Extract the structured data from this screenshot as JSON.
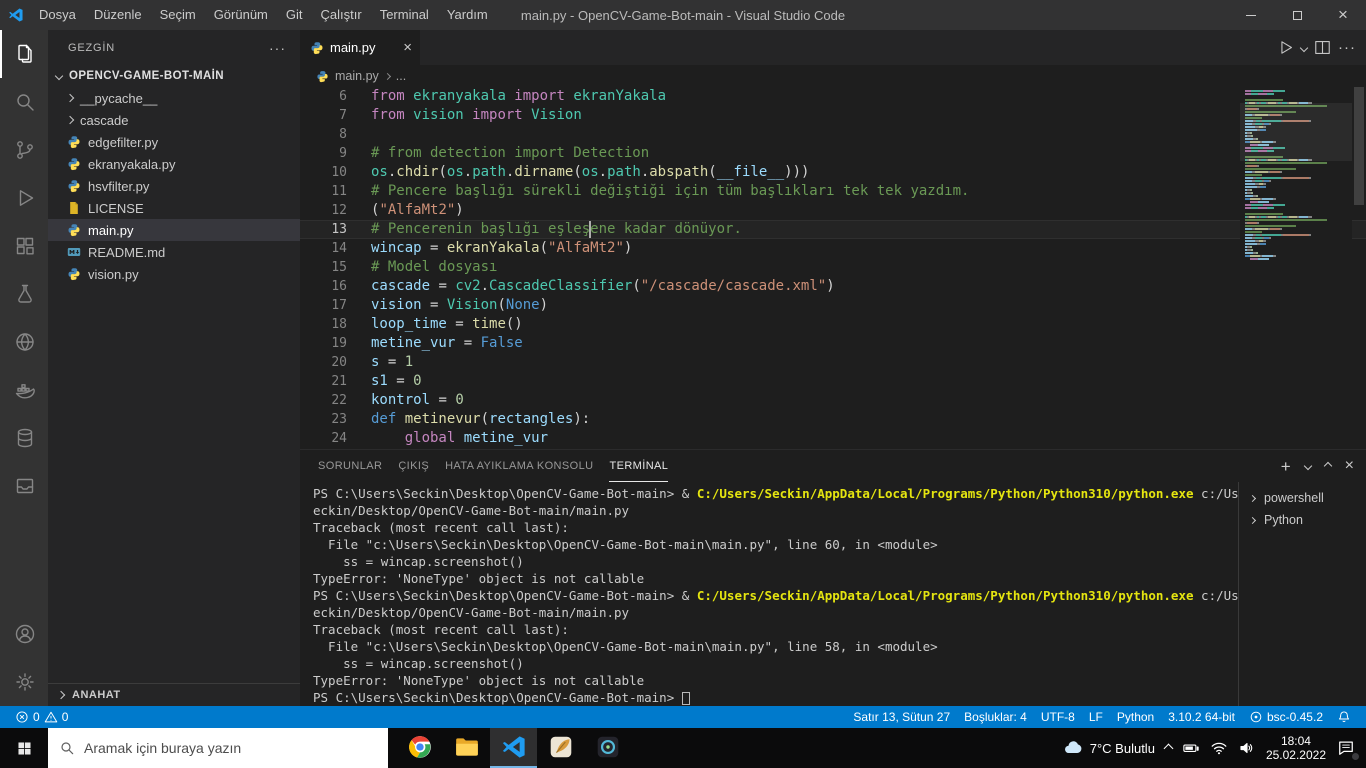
{
  "colors": {
    "accent": "#007acc",
    "titlebar": "#323233",
    "activitybar": "#333333",
    "sidebar": "#252526",
    "editor": "#1e1e1e",
    "taskbar": "#0b0b0c"
  },
  "titlebar": {
    "menus": [
      "Dosya",
      "Düzenle",
      "Seçim",
      "Görünüm",
      "Git",
      "Çalıştır",
      "Terminal",
      "Yardım"
    ],
    "title": "main.py - OpenCV-Game-Bot-main - Visual Studio Code"
  },
  "activitybar": {
    "top": [
      {
        "name": "explorer",
        "icon": "files",
        "active": true
      },
      {
        "name": "search",
        "icon": "search"
      },
      {
        "name": "source-control",
        "icon": "source-control"
      },
      {
        "name": "run-debug",
        "icon": "run-debug"
      },
      {
        "name": "extensions",
        "icon": "extensions"
      },
      {
        "name": "testing",
        "icon": "testing"
      },
      {
        "name": "remote-explorer",
        "icon": "globe"
      },
      {
        "name": "docker",
        "icon": "docker"
      },
      {
        "name": "database",
        "icon": "database"
      },
      {
        "name": "inbox",
        "icon": "inbox"
      }
    ],
    "bottom": [
      {
        "name": "account",
        "icon": "account"
      },
      {
        "name": "settings",
        "icon": "gear"
      }
    ]
  },
  "sidebar": {
    "title": "GEZGİN",
    "root_folder": "OPENCV-GAME-BOT-MAİN",
    "files": [
      {
        "name": "__pycache__",
        "type": "folder"
      },
      {
        "name": "cascade",
        "type": "folder"
      },
      {
        "name": "edgefilter.py",
        "type": "python"
      },
      {
        "name": "ekranyakala.py",
        "type": "python"
      },
      {
        "name": "hsvfilter.py",
        "type": "python"
      },
      {
        "name": "LICENSE",
        "type": "license"
      },
      {
        "name": "main.py",
        "type": "python",
        "selected": true
      },
      {
        "name": "README.md",
        "type": "markdown"
      },
      {
        "name": "vision.py",
        "type": "python"
      }
    ],
    "outline": "ANAHAT"
  },
  "editor": {
    "tab": {
      "label": "main.py"
    },
    "breadcrumb": {
      "file": "main.py",
      "ellipsis": "..."
    },
    "active_line": 13,
    "lines": [
      {
        "n": 6,
        "t": [
          [
            "from ",
            "kw"
          ],
          [
            "ekranyakala",
            "mod"
          ],
          [
            " import ",
            "kw"
          ],
          [
            "ekranYakala",
            "mod"
          ]
        ]
      },
      {
        "n": 7,
        "t": [
          [
            "from ",
            "kw"
          ],
          [
            "vision",
            "mod"
          ],
          [
            " import ",
            "kw"
          ],
          [
            "Vision",
            "mod"
          ]
        ]
      },
      {
        "n": 8,
        "t": []
      },
      {
        "n": 9,
        "t": [
          [
            "# from detection import Detection",
            "com"
          ]
        ]
      },
      {
        "n": 10,
        "t": [
          [
            "os",
            "mod"
          ],
          [
            ".",
            "pln"
          ],
          [
            "chdir",
            "fn"
          ],
          [
            "(",
            "pln"
          ],
          [
            "os",
            "mod"
          ],
          [
            ".",
            "pln"
          ],
          [
            "path",
            "mod"
          ],
          [
            ".",
            "pln"
          ],
          [
            "dirname",
            "fn"
          ],
          [
            "(",
            "pln"
          ],
          [
            "os",
            "mod"
          ],
          [
            ".",
            "pln"
          ],
          [
            "path",
            "mod"
          ],
          [
            ".",
            "pln"
          ],
          [
            "abspath",
            "fn"
          ],
          [
            "(",
            "pln"
          ],
          [
            "__file__",
            "var"
          ],
          [
            ")))",
            "pln"
          ]
        ]
      },
      {
        "n": 11,
        "t": [
          [
            "# Pencere başlığı sürekli değiştiği için tüm başlıkları tek tek yazdım.",
            "com"
          ]
        ]
      },
      {
        "n": 12,
        "t": [
          [
            "(",
            "pln"
          ],
          [
            "\"AlfaMt2\"",
            "str"
          ],
          [
            ")",
            "pln"
          ]
        ]
      },
      {
        "n": 13,
        "t": [
          [
            "# Pencerenin başlığı eşleş",
            "com"
          ],
          [
            "",
            "cur"
          ],
          [
            "ene kadar dönüyor.",
            "com"
          ]
        ]
      },
      {
        "n": 14,
        "t": [
          [
            "wincap",
            "var"
          ],
          [
            " = ",
            "pln"
          ],
          [
            "ekranYakala",
            "fn"
          ],
          [
            "(",
            "pln"
          ],
          [
            "\"AlfaMt2\"",
            "str"
          ],
          [
            ")",
            "pln"
          ]
        ]
      },
      {
        "n": 15,
        "t": [
          [
            "# Model dosyası",
            "com"
          ]
        ]
      },
      {
        "n": 16,
        "t": [
          [
            "cascade",
            "var"
          ],
          [
            " = ",
            "pln"
          ],
          [
            "cv2",
            "mod"
          ],
          [
            ".",
            "pln"
          ],
          [
            "CascadeClassifier",
            "mod"
          ],
          [
            "(",
            "pln"
          ],
          [
            "\"/cascade/cascade.xml\"",
            "str"
          ],
          [
            ")",
            "pln"
          ]
        ]
      },
      {
        "n": 17,
        "t": [
          [
            "vision",
            "var"
          ],
          [
            " = ",
            "pln"
          ],
          [
            "Vision",
            "mod"
          ],
          [
            "(",
            "pln"
          ],
          [
            "None",
            "cst"
          ],
          [
            ")",
            "pln"
          ]
        ]
      },
      {
        "n": 18,
        "t": [
          [
            "loop_time",
            "var"
          ],
          [
            " = ",
            "pln"
          ],
          [
            "time",
            "fn"
          ],
          [
            "()",
            "pln"
          ]
        ]
      },
      {
        "n": 19,
        "t": [
          [
            "metine_vur",
            "var"
          ],
          [
            " = ",
            "pln"
          ],
          [
            "False",
            "cst"
          ]
        ]
      },
      {
        "n": 20,
        "t": [
          [
            "s",
            "var"
          ],
          [
            " = ",
            "pln"
          ],
          [
            "1",
            "num"
          ]
        ]
      },
      {
        "n": 21,
        "t": [
          [
            "s1",
            "var"
          ],
          [
            " = ",
            "pln"
          ],
          [
            "0",
            "num"
          ]
        ]
      },
      {
        "n": 22,
        "t": [
          [
            "kontrol",
            "var"
          ],
          [
            " = ",
            "pln"
          ],
          [
            "0",
            "num"
          ]
        ]
      },
      {
        "n": 23,
        "t": [
          [
            "def ",
            "cst"
          ],
          [
            "metinevur",
            "fn"
          ],
          [
            "(",
            "pln"
          ],
          [
            "rectangles",
            "var"
          ],
          [
            "):",
            "pln"
          ]
        ]
      },
      {
        "n": 24,
        "t": [
          [
            "    ",
            "pln"
          ],
          [
            "global ",
            "kw"
          ],
          [
            "metine_vur",
            "var"
          ]
        ]
      }
    ]
  },
  "panel": {
    "tabs": [
      {
        "label": "SORUNLAR"
      },
      {
        "label": "ÇIKIŞ"
      },
      {
        "label": "HATA AYIKLAMA KONSOLU"
      },
      {
        "label": "TERMİNAL",
        "active": true
      }
    ],
    "terminal_lines": [
      [
        [
          "PS C:\\Users\\Seckin\\Desktop\\OpenCV-Game-Bot-main> & ",
          "p"
        ],
        [
          "C:/Users/Seckin/AppData/Local/Programs/Python/Python310/python.exe",
          "y"
        ],
        [
          " c:/Users/S",
          "p"
        ]
      ],
      [
        [
          "eckin/Desktop/OpenCV-Game-Bot-main/main.py",
          "p"
        ]
      ],
      [
        [
          "Traceback (most recent call last):",
          "p"
        ]
      ],
      [
        [
          "  File \"c:\\Users\\Seckin\\Desktop\\OpenCV-Game-Bot-main\\main.py\", line 60, in <module>",
          "p"
        ]
      ],
      [
        [
          "    ss = wincap.screenshot()",
          "p"
        ]
      ],
      [
        [
          "TypeError: 'NoneType' object is not callable",
          "p"
        ]
      ],
      [
        [
          "PS C:\\Users\\Seckin\\Desktop\\OpenCV-Game-Bot-main> & ",
          "p"
        ],
        [
          "C:/Users/Seckin/AppData/Local/Programs/Python/Python310/python.exe",
          "y"
        ],
        [
          " c:/Users/S",
          "p"
        ]
      ],
      [
        [
          "eckin/Desktop/OpenCV-Game-Bot-main/main.py",
          "p"
        ]
      ],
      [
        [
          "Traceback (most recent call last):",
          "p"
        ]
      ],
      [
        [
          "  File \"c:\\Users\\Seckin\\Desktop\\OpenCV-Game-Bot-main\\main.py\", line 58, in <module>",
          "p"
        ]
      ],
      [
        [
          "    ss = wincap.screenshot()",
          "p"
        ]
      ],
      [
        [
          "TypeError: 'NoneType' object is not callable",
          "p"
        ]
      ],
      [
        [
          "PS C:\\Users\\Seckin\\Desktop\\OpenCV-Game-Bot-main> ",
          "p"
        ],
        [
          "",
          "cur"
        ]
      ]
    ],
    "terminal_list": [
      "powershell",
      "Python"
    ]
  },
  "statusbar": {
    "errors": "0",
    "warnings": "0",
    "cursor_position": "Satır 13, Sütun 27",
    "indentation": "Boşluklar: 4",
    "encoding": "UTF-8",
    "eol": "LF",
    "language": "Python",
    "interpreter": "3.10.2 64-bit",
    "extension": "bsc-0.45.2"
  },
  "taskbar": {
    "search_placeholder": "Aramak için buraya yazın",
    "apps": [
      {
        "name": "chrome",
        "icon": "chrome"
      },
      {
        "name": "file-explorer",
        "icon": "folder"
      },
      {
        "name": "vscode",
        "icon": "vscode",
        "active": true
      },
      {
        "name": "notepad-app",
        "icon": "quill-app"
      },
      {
        "name": "python-app",
        "icon": "dark-app"
      }
    ],
    "weather": "7°C Bulutlu",
    "time": "18:04",
    "date": "25.02.2022"
  }
}
